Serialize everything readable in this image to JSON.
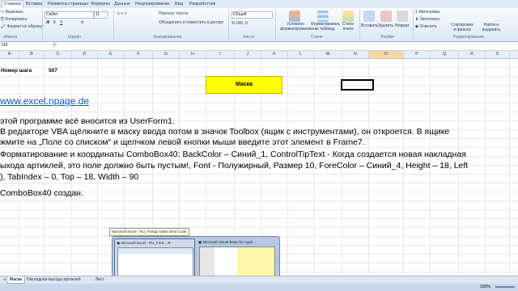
{
  "ribbon_tabs": [
    "Главная",
    "Вставка",
    "Разметка страницы",
    "Формулы",
    "Данные",
    "Рецензирование",
    "Вид",
    "Разработчик"
  ],
  "ribbon": {
    "cut": "Вырезать",
    "copy": "Копировать",
    "format_painter": "Формат по образцу",
    "font_name": "Calibri",
    "font_size": "11",
    "wrap_text": "Перенос текста",
    "merge_center": "Объединить и поместить в центре",
    "number_format": "Общий",
    "cond_format": "Условное форматирование",
    "format_table": "Форматировать как таблицу",
    "cell_styles": "Стили ячеек",
    "insert": "Вставить",
    "delete": "Удалить",
    "format": "Формат",
    "autosum": "Автосумма",
    "fill": "Заполнить",
    "clear": "Очистить",
    "sort_filter": "Сортировка и фильтр",
    "find_select": "Найти и выделить",
    "groups": [
      "обмена",
      "Шрифт",
      "Выравнивание",
      "Число",
      "Стили",
      "Ячейки",
      "Редактирование"
    ]
  },
  "name_box": "O3",
  "fx_label": "fx",
  "columns": [
    "A",
    "B",
    "C",
    "D",
    "E",
    "F",
    "G",
    "H",
    "I",
    "J",
    "K",
    "L",
    "M",
    "N",
    "O",
    "P",
    "Q",
    "R",
    "S"
  ],
  "selected_column": "O",
  "cells": {
    "label": "Номер шага",
    "value": "507"
  },
  "mask_button": "Маска",
  "link": "www.excel.npage.de",
  "body_lines": [
    "этой программе всё вносится из UserForm1.",
    "В редакторе VBA щёлкните в маску ввода потом в значок Toolbox (ящик с инструментами), он откроется. В ящике",
    "жмите на „Поле со списком“ и щелчком левой кнопки мыши введите этот элемент в Frame7.",
    "Форматирование и координаты ComboBox40: BackColor – Синий_1, ControlTipText - Когда создается новая накладная",
    "ыхода артиклей, это поле должно быть пустым!, Font - Полужирный, Размер 10, ForeColor – Синий_4, Height – 18, Left",
    "), TabIndex – 0, Top – 18, Width – 90",
    "ComboBox40 создан."
  ],
  "taskbar": {
    "tooltip": "Microsoft Excel - RU_Fertige Datei ohne Code",
    "thumb1": "Microsoft Excel - RU_Ferti...",
    "thumb2": "Microsoft Visual Basic for Appli..."
  },
  "sheet_tabs": [
    "Маска",
    "Накладная выхода артиклей",
    "Лист"
  ],
  "status": {
    "zoom": "100%"
  }
}
